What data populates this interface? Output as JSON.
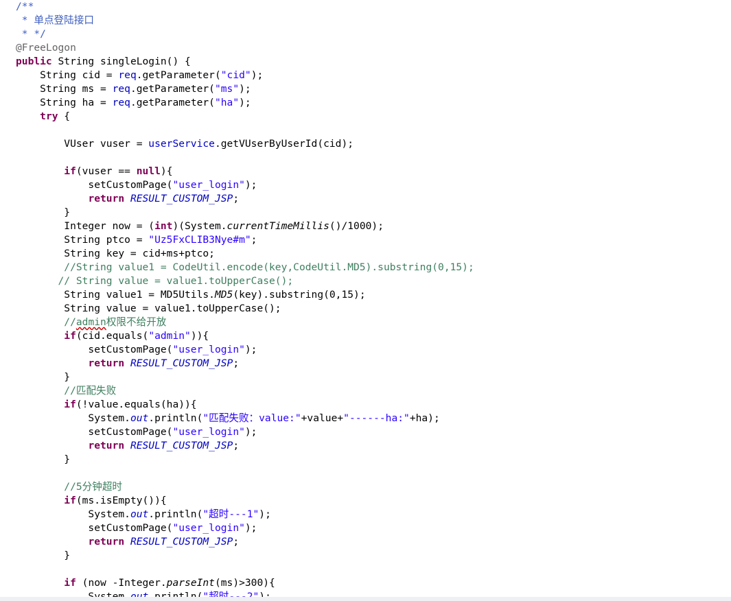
{
  "code_lines": [
    [
      {
        "t": "/**",
        "c": "jdoc"
      }
    ],
    [
      {
        "t": " * 单点登陆接口",
        "c": "jdoc"
      }
    ],
    [
      {
        "t": " * */",
        "c": "jdoc"
      }
    ],
    [
      {
        "t": "@FreeLogon",
        "c": "ann"
      }
    ],
    [
      {
        "t": "public",
        "c": "kw"
      },
      {
        "t": " String singleLogin() {"
      }
    ],
    [
      {
        "t": "    String cid = "
      },
      {
        "t": "req",
        "c": "fld"
      },
      {
        "t": ".getParameter("
      },
      {
        "t": "\"cid\"",
        "c": "str"
      },
      {
        "t": ");"
      }
    ],
    [
      {
        "t": "    String ms = "
      },
      {
        "t": "req",
        "c": "fld"
      },
      {
        "t": ".getParameter("
      },
      {
        "t": "\"ms\"",
        "c": "str"
      },
      {
        "t": ");"
      }
    ],
    [
      {
        "t": "    String ha = "
      },
      {
        "t": "req",
        "c": "fld"
      },
      {
        "t": ".getParameter("
      },
      {
        "t": "\"ha\"",
        "c": "str"
      },
      {
        "t": ");"
      }
    ],
    [
      {
        "t": "    "
      },
      {
        "t": "try",
        "c": "kw"
      },
      {
        "t": " {"
      }
    ],
    [],
    [
      {
        "t": "        VUser vuser = "
      },
      {
        "t": "userService",
        "c": "fld"
      },
      {
        "t": ".getVUserByUserId(cid);"
      }
    ],
    [],
    [
      {
        "t": "        "
      },
      {
        "t": "if",
        "c": "kw"
      },
      {
        "t": "(vuser == "
      },
      {
        "t": "null",
        "c": "kw"
      },
      {
        "t": "){"
      }
    ],
    [
      {
        "t": "            setCustomPage("
      },
      {
        "t": "\"user_login\"",
        "c": "str"
      },
      {
        "t": ");"
      }
    ],
    [
      {
        "t": "            "
      },
      {
        "t": "return",
        "c": "kw"
      },
      {
        "t": " "
      },
      {
        "t": "RESULT_CUSTOM_JSP",
        "c": "stat"
      },
      {
        "t": ";"
      }
    ],
    [
      {
        "t": "        }"
      }
    ],
    [
      {
        "t": "        Integer now = ("
      },
      {
        "t": "int",
        "c": "kw"
      },
      {
        "t": ")(System."
      },
      {
        "t": "currentTimeMillis",
        "c": "smeth"
      },
      {
        "t": "()/1000);"
      }
    ],
    [
      {
        "t": "        String ptco = "
      },
      {
        "t": "\"Uz5FxCLIB3Nye#m\"",
        "c": "str"
      },
      {
        "t": ";"
      }
    ],
    [
      {
        "t": "        String key = cid+ms+ptco;"
      }
    ],
    [
      {
        "t": "        //String value1 = CodeUtil.encode(key,CodeUtil.MD5).substring(0,15);",
        "c": "com"
      }
    ],
    [
      {
        "t": "       // String value = value1.toUpperCase();",
        "c": "com"
      }
    ],
    [
      {
        "t": "        String value1 = MD5Utils."
      },
      {
        "t": "MD5",
        "c": "smeth"
      },
      {
        "t": "(key).substring(0,15);"
      }
    ],
    [
      {
        "t": "        String value = value1.toUpperCase();"
      }
    ],
    [
      {
        "t": "        //",
        "c": "com"
      },
      {
        "t": "admin",
        "c": "com sq"
      },
      {
        "t": "权限不给开放",
        "c": "com"
      }
    ],
    [
      {
        "t": "        "
      },
      {
        "t": "if",
        "c": "kw"
      },
      {
        "t": "(cid.equals("
      },
      {
        "t": "\"admin\"",
        "c": "str"
      },
      {
        "t": ")){"
      }
    ],
    [
      {
        "t": "            setCustomPage("
      },
      {
        "t": "\"user_login\"",
        "c": "str"
      },
      {
        "t": ");"
      }
    ],
    [
      {
        "t": "            "
      },
      {
        "t": "return",
        "c": "kw"
      },
      {
        "t": " "
      },
      {
        "t": "RESULT_CUSTOM_JSP",
        "c": "stat"
      },
      {
        "t": ";"
      }
    ],
    [
      {
        "t": "        }"
      }
    ],
    [
      {
        "t": "        //匹配失败",
        "c": "com"
      }
    ],
    [
      {
        "t": "        "
      },
      {
        "t": "if",
        "c": "kw"
      },
      {
        "t": "(!value.equals(ha)){"
      }
    ],
    [
      {
        "t": "            System."
      },
      {
        "t": "out",
        "c": "stat"
      },
      {
        "t": ".println("
      },
      {
        "t": "\"匹配失败：value:\"",
        "c": "str"
      },
      {
        "t": "+value+"
      },
      {
        "t": "\"------ha:\"",
        "c": "str"
      },
      {
        "t": "+ha);"
      }
    ],
    [
      {
        "t": "            setCustomPage("
      },
      {
        "t": "\"user_login\"",
        "c": "str"
      },
      {
        "t": ");"
      }
    ],
    [
      {
        "t": "            "
      },
      {
        "t": "return",
        "c": "kw"
      },
      {
        "t": " "
      },
      {
        "t": "RESULT_CUSTOM_JSP",
        "c": "stat"
      },
      {
        "t": ";"
      }
    ],
    [
      {
        "t": "        }"
      }
    ],
    [],
    [
      {
        "t": "        //5分钟超时",
        "c": "com"
      }
    ],
    [
      {
        "t": "        "
      },
      {
        "t": "if",
        "c": "kw"
      },
      {
        "t": "(ms.isEmpty()){"
      }
    ],
    [
      {
        "t": "            System."
      },
      {
        "t": "out",
        "c": "stat"
      },
      {
        "t": ".println("
      },
      {
        "t": "\"超时---1\"",
        "c": "str"
      },
      {
        "t": ");"
      }
    ],
    [
      {
        "t": "            setCustomPage("
      },
      {
        "t": "\"user_login\"",
        "c": "str"
      },
      {
        "t": ");"
      }
    ],
    [
      {
        "t": "            "
      },
      {
        "t": "return",
        "c": "kw"
      },
      {
        "t": " "
      },
      {
        "t": "RESULT_CUSTOM_JSP",
        "c": "stat"
      },
      {
        "t": ";"
      }
    ],
    [
      {
        "t": "        }"
      }
    ],
    [],
    [
      {
        "t": "        "
      },
      {
        "t": "if",
        "c": "kw"
      },
      {
        "t": " (now -Integer."
      },
      {
        "t": "parseInt",
        "c": "smeth"
      },
      {
        "t": "(ms)>300){"
      }
    ],
    [
      {
        "t": "            System."
      },
      {
        "t": "out",
        "c": "stat"
      },
      {
        "t": ".println("
      },
      {
        "t": "\"超时---2\"",
        "c": "str"
      },
      {
        "t": ");"
      }
    ]
  ],
  "colors": {
    "keyword": "#7f0055",
    "string": "#2a00ff",
    "comment": "#3f7f5f",
    "javadoc": "#3f5fbf",
    "annotation": "#646464",
    "field": "#0000c0",
    "background": "#ffffff"
  }
}
